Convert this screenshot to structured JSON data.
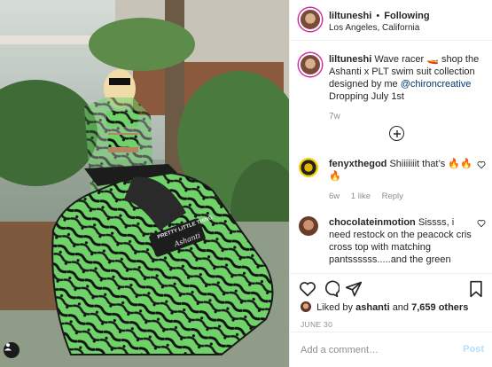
{
  "post": {
    "username": "liltuneshi",
    "follow_separator": "•",
    "follow_status": "Following",
    "location": "Los Angeles, California"
  },
  "caption": {
    "username": "liltuneshi",
    "text_part1": "Wave racer",
    "emoji": "🚤",
    "text_part2": "shop the Ashanti x PLT swim suit collection designed by me",
    "mention": "@chironcreative",
    "text_part3": "Dropping July 1st",
    "age": "7w"
  },
  "comments": [
    {
      "username": "fenyxthegod",
      "text": "Shiiiiiiit that’s 🔥🔥🔥",
      "age": "6w",
      "likes": "1 like",
      "reply_label": "Reply"
    },
    {
      "username": "chocolateinmotion",
      "text": "Sissss, i need restock on the peacock cris cross top with matching pantssssss.....and the green lattice top.....i can’t!!!! You killed 🖤🙌"
    }
  ],
  "engagement": {
    "liked_by_prefix": "Liked by",
    "liked_by_user": "ashanti",
    "and": "and",
    "others": "7,659 others",
    "date": "JUNE 30"
  },
  "add_comment": {
    "placeholder": "Add a comment…",
    "post_label": "Post"
  },
  "photo": {
    "jetski_text_line1": "PRETTY LITTLE THING",
    "jetski_text_line2": "Ashanti"
  },
  "colors": {
    "accent_link": "#00376b",
    "muted": "#8e8e8e",
    "post_disabled": "#b2dffc",
    "story_ring": "#d6249f",
    "jetski_green": "#6fd36a"
  },
  "icons": [
    "more-icon",
    "heart-icon",
    "comment-icon",
    "share-icon",
    "bookmark-icon",
    "user-tag-icon"
  ]
}
